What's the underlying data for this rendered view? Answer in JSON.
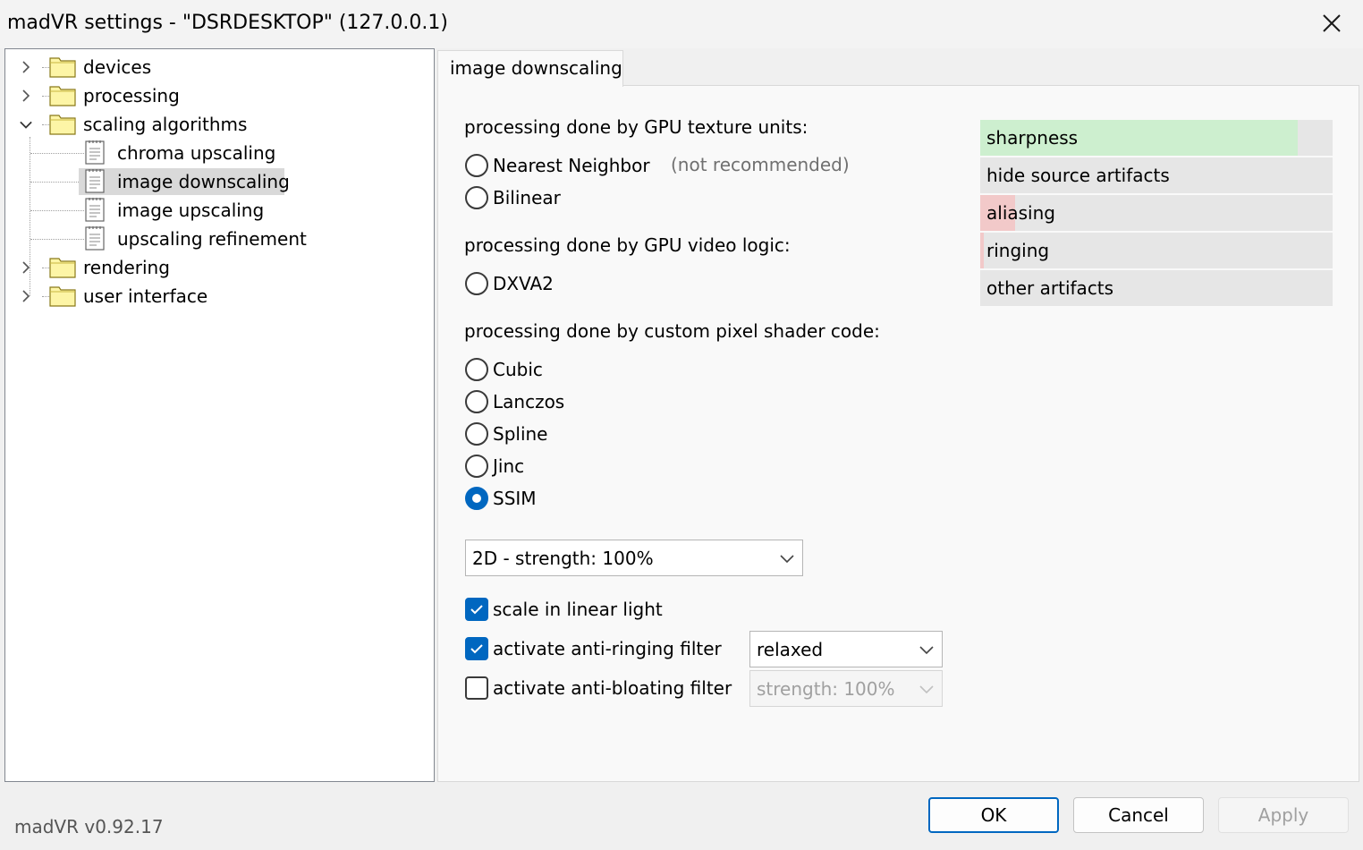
{
  "window": {
    "title": "madVR settings - \"DSRDESKTOP\" (127.0.0.1)"
  },
  "tree": {
    "items": [
      {
        "label": "devices"
      },
      {
        "label": "processing"
      },
      {
        "label": "scaling algorithms"
      },
      {
        "label": "chroma upscaling"
      },
      {
        "label": "image downscaling"
      },
      {
        "label": "image upscaling"
      },
      {
        "label": "upscaling refinement"
      },
      {
        "label": "rendering"
      },
      {
        "label": "user interface"
      }
    ],
    "selected": "image downscaling"
  },
  "tab": {
    "label": "image downscaling"
  },
  "gpu_texture": {
    "label": "processing done by GPU texture units:",
    "options": [
      "Nearest Neighbor",
      "Bilinear"
    ],
    "note": "(not recommended)"
  },
  "gpu_video": {
    "label": "processing done by GPU video logic:",
    "options": [
      "DXVA2"
    ]
  },
  "pixel_shader": {
    "label": "processing done by custom pixel shader code:",
    "options": [
      "Cubic",
      "Lanczos",
      "Spline",
      "Jinc",
      "SSIM"
    ],
    "selected": "SSIM"
  },
  "strength_combo": {
    "value": "2D - strength: 100%"
  },
  "options": {
    "linear_light": {
      "label": "scale in linear light",
      "checked": true
    },
    "anti_ringing": {
      "label": "activate anti-ringing filter",
      "checked": true,
      "combo": "relaxed"
    },
    "anti_bloating": {
      "label": "activate anti-bloating filter",
      "checked": false,
      "combo": "strength: 100%"
    }
  },
  "quality": [
    {
      "label": "sharpness",
      "level": 0.9,
      "color": "#cdefcf"
    },
    {
      "label": "hide source artifacts",
      "level": 0,
      "color": "#cdefcf"
    },
    {
      "label": "aliasing",
      "level": 0.1,
      "color": "#f2c9c9"
    },
    {
      "label": "ringing",
      "level": 0.01,
      "color": "#f2c9c9"
    },
    {
      "label": "other artifacts",
      "level": 0,
      "color": "#f2c9c9"
    }
  ],
  "footer": {
    "version": "madVR v0.92.17",
    "ok": "OK",
    "cancel": "Cancel",
    "apply": "Apply"
  },
  "colors": {
    "accent": "#0067c0",
    "selection": "#d9d9d9"
  }
}
